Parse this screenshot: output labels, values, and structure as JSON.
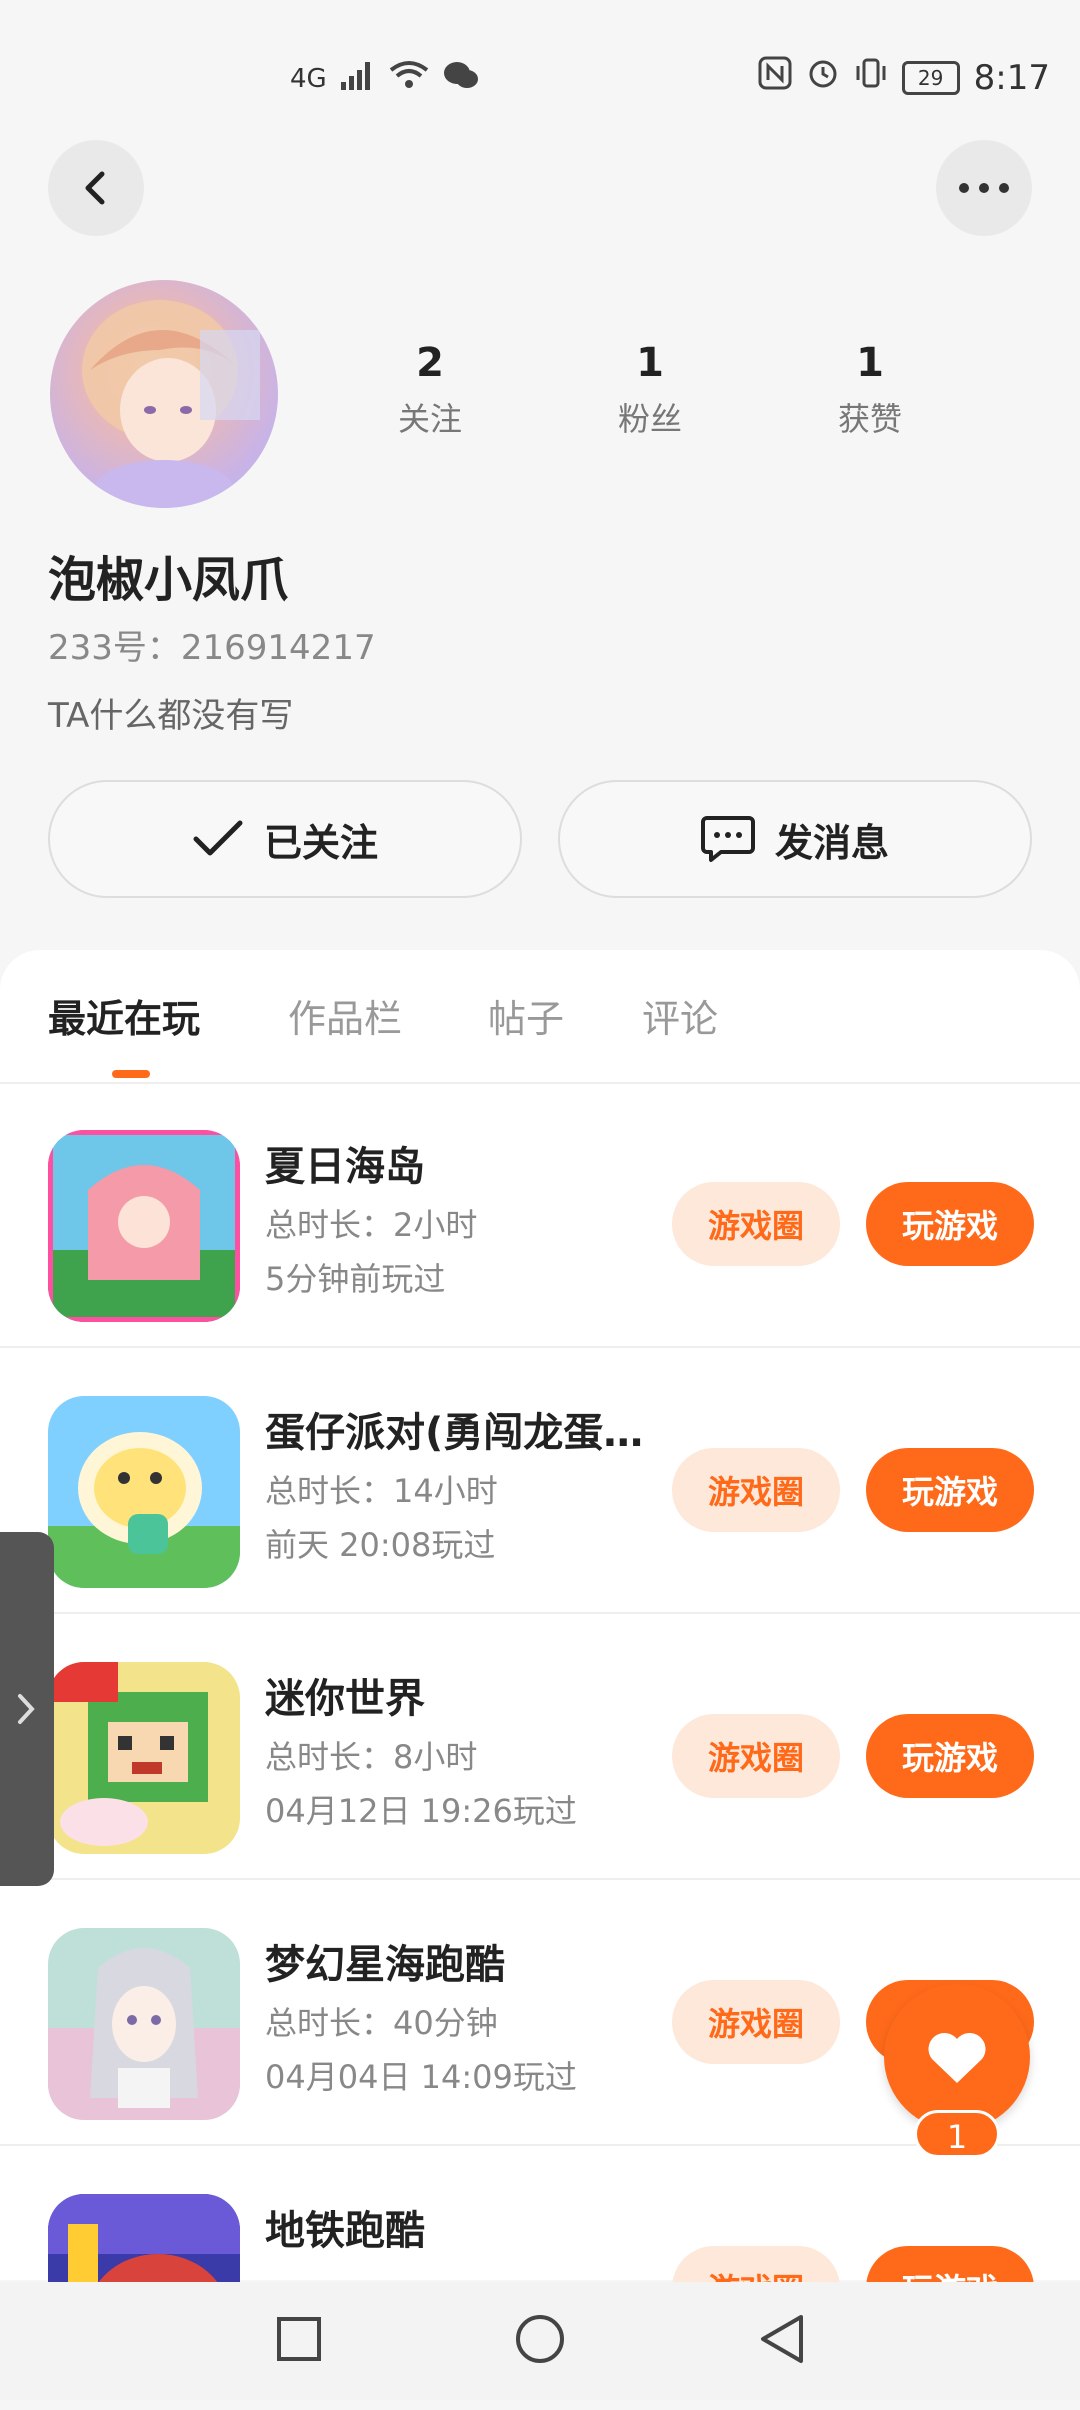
{
  "status_bar": {
    "network": "4G",
    "battery": "29",
    "time": "8:17"
  },
  "profile": {
    "name": "泡椒小凤爪",
    "uid": "233号：216914217",
    "bio": "TA什么都没有写",
    "stats": [
      {
        "num": "2",
        "label": "关注"
      },
      {
        "num": "1",
        "label": "粉丝"
      },
      {
        "num": "1",
        "label": "获赞"
      }
    ],
    "follow_label": "已关注",
    "message_label": "发消息"
  },
  "tabs": [
    {
      "label": "最近在玩",
      "active": true
    },
    {
      "label": "作品栏",
      "active": false
    },
    {
      "label": "帖子",
      "active": false
    },
    {
      "label": "评论",
      "active": false
    }
  ],
  "games": [
    {
      "title": "夏日海岛",
      "duration": "总时长：2小时",
      "last_played": "5分钟前玩过",
      "circle_label": "游戏圈",
      "play_label": "玩游戏"
    },
    {
      "title": "蛋仔派对(勇闯龙蛋…",
      "duration": "总时长：14小时",
      "last_played": "前天 20:08玩过",
      "circle_label": "游戏圈",
      "play_label": "玩游戏"
    },
    {
      "title": "迷你世界",
      "duration": "总时长：8小时",
      "last_played": "04月12日 19:26玩过",
      "circle_label": "游戏圈",
      "play_label": "玩游戏"
    },
    {
      "title": "梦幻星海跑酷",
      "duration": "总时长：40分钟",
      "last_played": "04月04日 14:09玩过",
      "circle_label": "游戏圈",
      "play_label": "玩游戏"
    },
    {
      "title": "地铁跑酷",
      "duration": "",
      "last_played": "",
      "circle_label": "游戏圈",
      "play_label": "玩游戏"
    }
  ],
  "like_fab": {
    "count": "1"
  },
  "colors": {
    "accent": "#ff6a1a",
    "accent_light": "#fde8da"
  }
}
